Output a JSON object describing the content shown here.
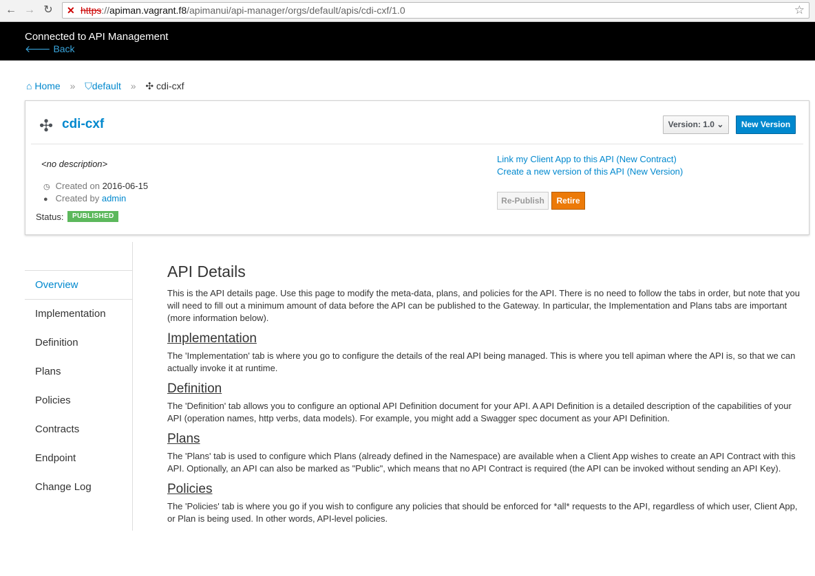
{
  "browser": {
    "url_scheme": "https",
    "url_sep": "://",
    "url_host": "apiman.vagrant.f8",
    "url_path": "/apimanui/api-manager/orgs/default/apis/cdi-cxf/1.0",
    "back_icon": "arrow-left-icon",
    "forward_icon": "arrow-right-icon",
    "reload_icon": "reload-icon",
    "bookmark_icon": "star-icon"
  },
  "header": {
    "title": "Connected to API Management",
    "back_label": "Back"
  },
  "breadcrumb": [
    {
      "label": "Home",
      "icon": "home-icon"
    },
    {
      "label": "default",
      "icon": "shield-icon"
    },
    {
      "label": "cdi-cxf",
      "icon": "puzzle-icon"
    }
  ],
  "api": {
    "name": "cdi-cxf",
    "icon": "puzzle-icon",
    "version_label": "Version: 1.0",
    "new_version_label": "New Version",
    "description": "<no description>",
    "created_on_label": "Created on",
    "created_on": "2016-06-15",
    "created_by_label": "Created by",
    "created_by": "admin",
    "status_label": "Status:",
    "status": "PUBLISHED",
    "link_contract": "Link my Client App to this API (New Contract)",
    "link_new_version": "Create a new version of this API (New Version)",
    "republish_label": "Re-Publish",
    "retire_label": "Retire"
  },
  "sidenav": {
    "items": [
      {
        "label": "Overview",
        "active": true
      },
      {
        "label": "Implementation"
      },
      {
        "label": "Definition"
      },
      {
        "label": "Plans"
      },
      {
        "label": "Policies"
      },
      {
        "label": "Contracts"
      },
      {
        "label": "Endpoint"
      },
      {
        "label": "Change Log"
      }
    ]
  },
  "content": {
    "title": "API Details",
    "intro": "This is the API details page. Use this page to modify the meta-data, plans, and policies for the API. There is no need to follow the tabs in order, but note that you will need to fill out a minimum amount of data before the API can be published to the Gateway. In particular, the Implementation and Plans tabs are important (more information below).",
    "sections": [
      {
        "heading": "Implementation",
        "text": "The 'Implementation' tab is where you go to configure the details of the real API being managed. This is where you tell apiman where the API is, so that we can actually invoke it at runtime."
      },
      {
        "heading": "Definition",
        "text": "The 'Definition' tab allows you to configure an optional API Definition document for your API. A API Definition is a detailed description of the capabilities of your API (operation names, http verbs, data models). For example, you might add a Swagger spec document as your API Definition."
      },
      {
        "heading": "Plans",
        "text": "The 'Plans' tab is used to configure which Plans (already defined in the Namespace) are available when a Client App wishes to create an API Contract with this API. Optionally, an API can also be marked as \"Public\", which means that no API Contract is required (the API can be invoked without sending an API Key)."
      },
      {
        "heading": "Policies",
        "text": "The 'Policies' tab is where you go if you wish to configure any policies that should be enforced for *all* requests to the API, regardless of which user, Client App, or Plan is being used. In other words, API-level policies."
      }
    ]
  },
  "colors": {
    "link": "#0088ce",
    "status_published": "#5cb85c",
    "retire": "#ec7a08",
    "topbar": "#000000"
  }
}
